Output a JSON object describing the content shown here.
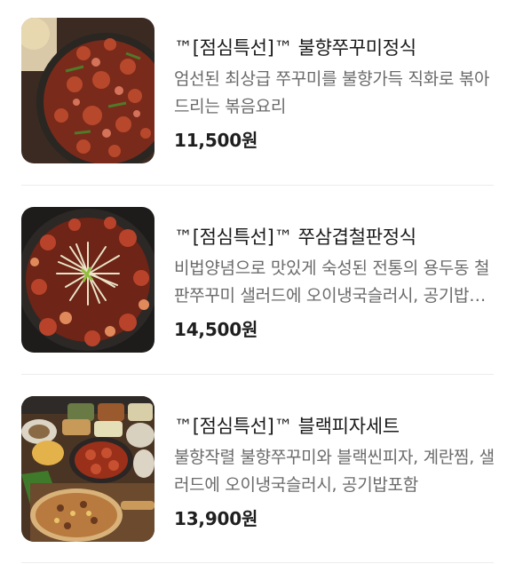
{
  "menu_items": [
    {
      "name": "™[점심특선]™ 불향쭈꾸미정식",
      "description": "엄선된 최상급 쭈꾸미를 불향가득 직화로 볶아드리는 볶음요리",
      "price": "11,500원",
      "image_icon": "spicy-webfoot-octopus-stirfry-photo"
    },
    {
      "name": "™[점심특선]™ 쭈삼겹철판정식",
      "description": "비법양념으로 맛있게 숙성된 전통의 용두동 철판쭈꾸미 샐러드에 오이냉국슬러시, 공기밥포함",
      "price": "14,500원",
      "image_icon": "iron-plate-octopus-pork-belly-photo"
    },
    {
      "name": "™[점심특선]™ 블랙피자세트",
      "description": "불향작렬 불향쭈꾸미와 블랙씬피자, 계란찜, 샐러드에 오이냉국슬러시, 공기밥포함",
      "price": "13,900원",
      "image_icon": "black-pizza-set-table-photo"
    }
  ]
}
